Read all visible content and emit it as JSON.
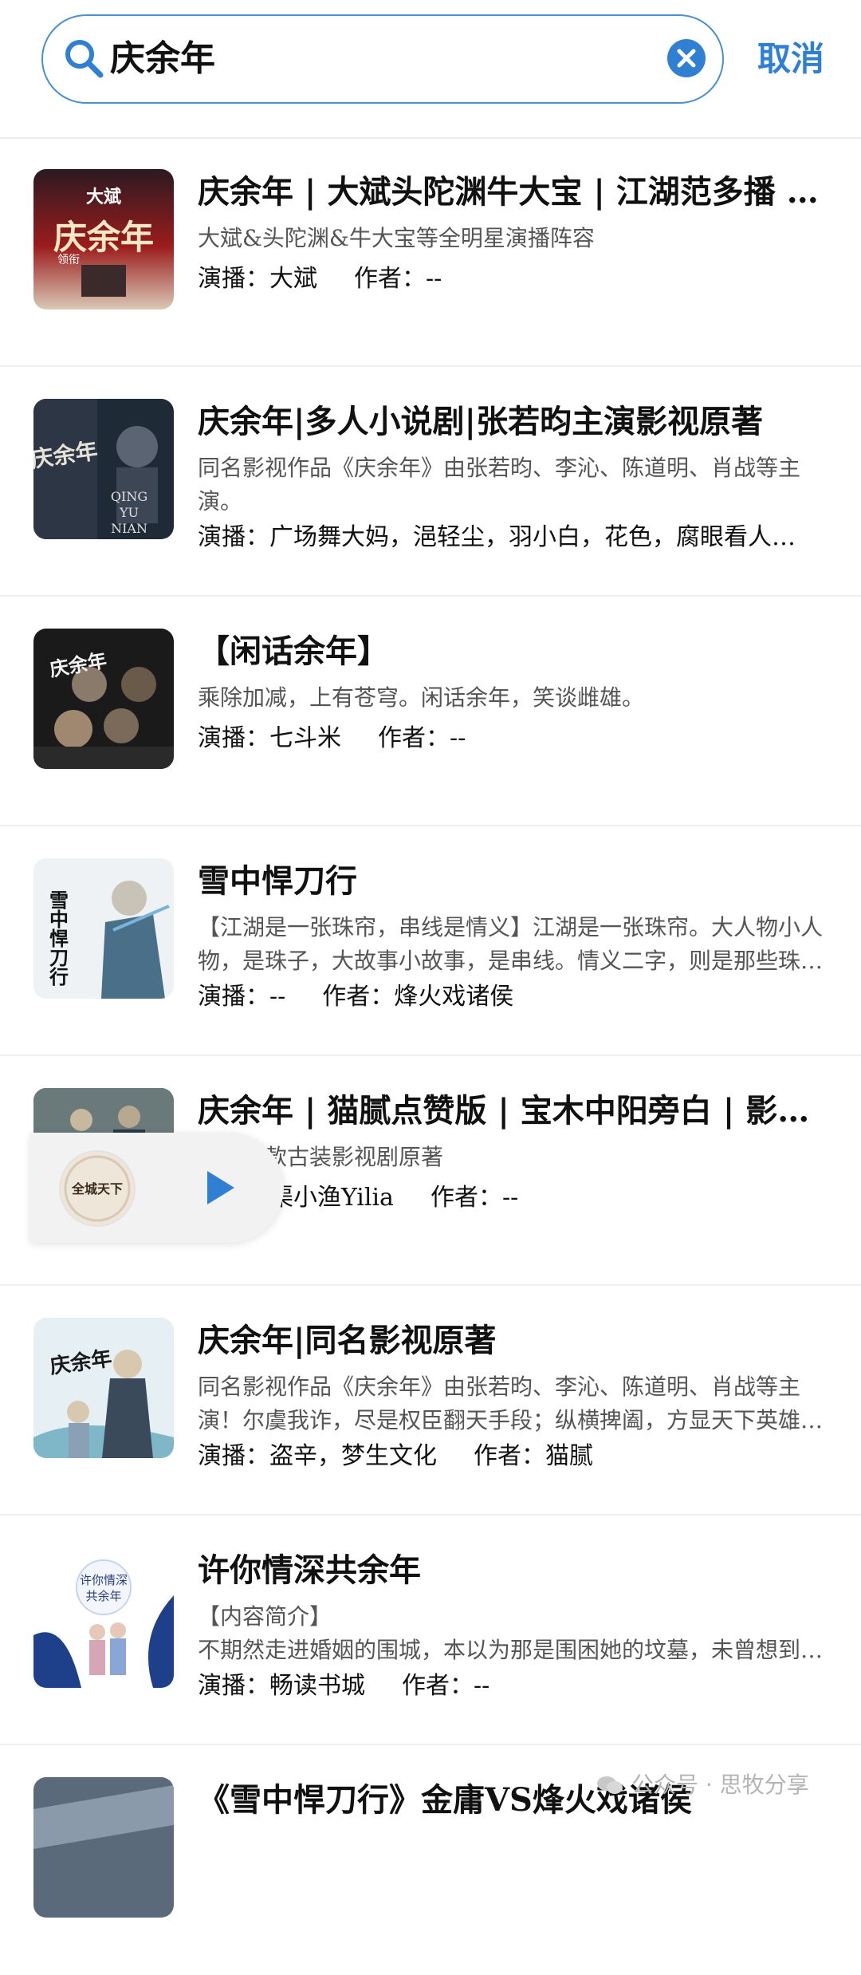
{
  "search": {
    "query": "庆余年",
    "cancel_label": "取消"
  },
  "results": [
    {
      "title": "庆余年 | 大斌头陀渊牛大宝 | 江湖范多播 | 庆余年第一季",
      "desc": "大斌&头陀渊&牛大宝等全明星演播阵容",
      "cast": "演播：大斌",
      "author": "作者：--"
    },
    {
      "title": "庆余年|多人小说剧|张若昀主演影视原著",
      "desc": "同名影视作品《庆余年》由张若昀、李沁、陈道明、肖战等主演。",
      "cast": "演播：广场舞大妈，浥轻尘，羽小白，花色，腐眼看人…",
      "author": ""
    },
    {
      "title": "【闲话余年】",
      "desc": "乘除加减，上有苍穹。闲话余年，笑谈雌雄。",
      "cast": "演播：七斗米",
      "author": "作者：--"
    },
    {
      "title": "雪中悍刀行",
      "desc": "【江湖是一张珠帘，串线是情义】江湖是一张珠帘。大人物小人物，是珠子，大故事小故事，是串线。情义二字，则是那些珠子和串线…",
      "cast": "演播：--",
      "author": "作者：烽火戏诸侯"
    },
    {
      "title": "庆余年 | 猫腻点赞版 | 宝木中阳旁白 | 影视原著",
      "desc": "主演爆款古装影视剧原著",
      "cast": "演播：渠小渔Yilia",
      "author": "作者：--"
    },
    {
      "title": "庆余年|同名影视原著",
      "desc": "同名影视作品《庆余年》由张若昀、李沁、陈道明、肖战等主演！尔虞我诈，尽是权臣翻天手段；纵横捭阖，方显天下英雄本色…",
      "cast": "演播：盗辛，梦生文化",
      "author": "作者：猫腻"
    },
    {
      "title": "许你情深共余年",
      "desc": "【内容简介】\n不期然走进婚姻的围城，本以为那是围困她的坟墓，未曾想到却是…",
      "cast": "演播：畅读书城",
      "author": "作者：--"
    },
    {
      "title": "《雪中悍刀行》金庸VS烽火戏诸侯",
      "desc": "",
      "cast": "",
      "author": ""
    }
  ],
  "covers": {
    "c1": {
      "small": "大斌",
      "big": "庆余年",
      "tag": "领衔"
    },
    "c2": {
      "big": "庆余年",
      "en1": "QING",
      "en2": "YU",
      "en3": "NIAN"
    },
    "c3": {
      "big": "庆余年"
    },
    "c4": {
      "big": "雪中悍刀行"
    },
    "c6": {
      "big": "庆余年"
    },
    "c7": {
      "line1": "许你情深",
      "line2": "共余年"
    }
  },
  "mini_player": {
    "disc_text": "全城天下"
  },
  "watermark": {
    "text": "公众号 · 思牧分享"
  },
  "colors": {
    "accent": "#2f7fd3",
    "search_border": "#4a8fd0"
  }
}
